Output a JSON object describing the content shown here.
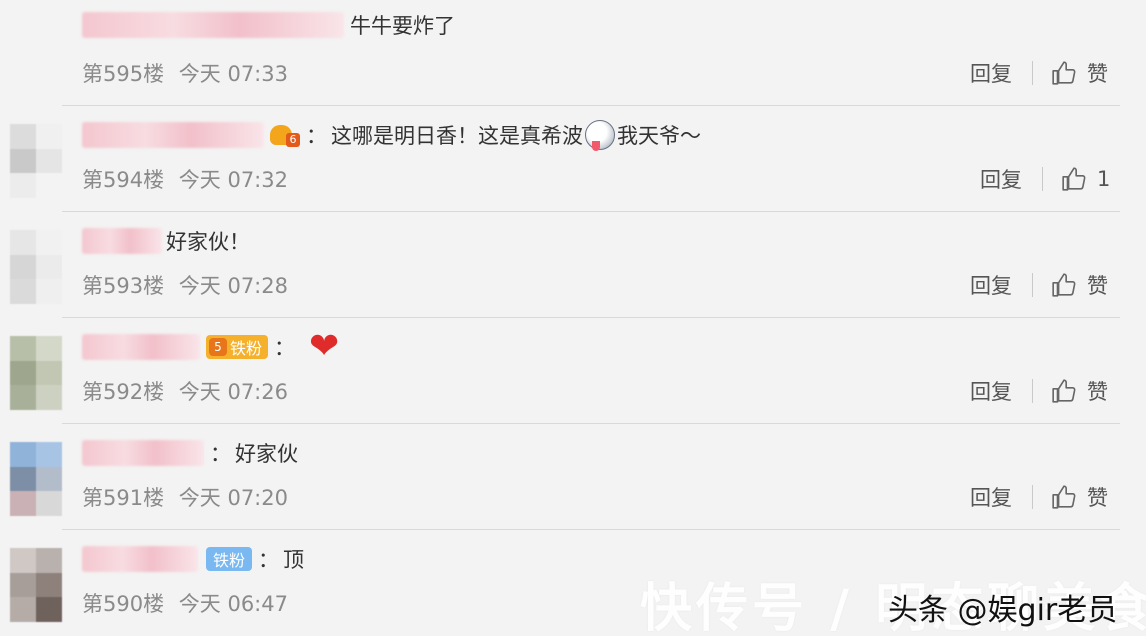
{
  "comments": [
    {
      "text": "牛牛要炸了",
      "floor": "第595楼",
      "time": "今天 07:33",
      "reply_label": "回复",
      "like_label": "赞"
    },
    {
      "level_badge": "6",
      "colon": "：",
      "text_a": "这哪是明日香！这是真希波",
      "text_b": "我天爷～",
      "floor": "第594楼",
      "time": "今天 07:32",
      "reply_label": "回复",
      "like_label": "1"
    },
    {
      "text": "好家伙！",
      "floor": "第593楼",
      "time": "今天 07:28",
      "reply_label": "回复",
      "like_label": "赞"
    },
    {
      "fans_level": "5",
      "fans_label": "铁粉",
      "colon": "：",
      "emoji": "❤",
      "floor": "第592楼",
      "time": "今天 07:26",
      "reply_label": "回复",
      "like_label": "赞"
    },
    {
      "colon": "：",
      "text": "好家伙",
      "floor": "第591楼",
      "time": "今天 07:20",
      "reply_label": "回复",
      "like_label": "赞"
    },
    {
      "badge": "铁粉",
      "colon": "：",
      "text": "顶",
      "floor": "第590楼",
      "time": "今天 06:47"
    }
  ],
  "watermark": "快传号 / 明态聊美食",
  "source_tag": "头条 @娱gir老员",
  "icons": [
    "thumbs-up-icon",
    "crown-badge-icon",
    "heart-emoji",
    "face-emoji"
  ],
  "colors": {
    "background": "#f3f3f3",
    "meta_text": "#8a8a8a",
    "fans_badge": "#f6b12c",
    "iron_badge": "#79b8f0",
    "heart": "#e02b2b"
  }
}
